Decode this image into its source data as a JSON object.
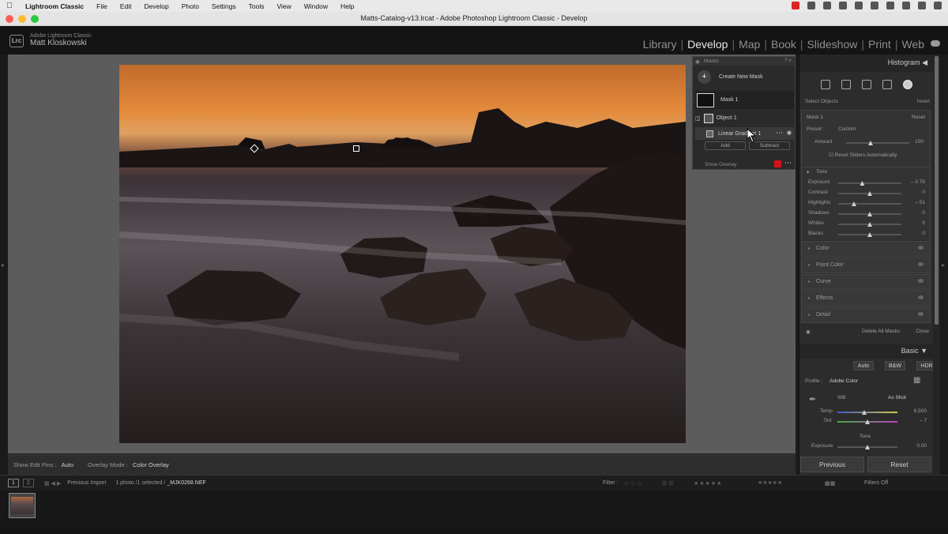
{
  "menubar": {
    "app": "Lightroom Classic",
    "items": [
      "File",
      "Edit",
      "Develop",
      "Photo",
      "Settings",
      "Tools",
      "View",
      "Window",
      "Help"
    ]
  },
  "window": {
    "title": "Matts-Catalog-v13.lrcat - Adobe Photoshop Lightroom Classic - Develop"
  },
  "identity": {
    "app_name": "Adobe Lightroom Classic",
    "user_name": "Matt Kloskowski",
    "logo_text": "Lrc"
  },
  "modules": [
    "Library",
    "Develop",
    "Map",
    "Book",
    "Slideshow",
    "Print",
    "Web"
  ],
  "active_module": "Develop",
  "masks_panel": {
    "title": "Masks",
    "create_label": "Create New Mask",
    "mask1_label": "Mask 1",
    "object_label": "Object 1",
    "linear_label": "Linear Gradient 1",
    "add_label": "Add",
    "subtract_label": "Subtract",
    "show_overlay_label": "Show Overlay",
    "overlay_color": "#d4121b"
  },
  "right_panel": {
    "histogram_title": "Histogram",
    "select_objects": "Select Objects",
    "invert": "Invert",
    "mask_name": "Mask 1",
    "reset": "Reset",
    "preset_label": "Preset :",
    "preset_value": "Custom",
    "amount_label": "Amount",
    "amount_value": "100",
    "reset_sliders_label": "Reset Sliders Automatically",
    "tone_title": "Tone",
    "sliders": [
      {
        "label": "Exposure",
        "value": "– 0.76",
        "pos": 0.38
      },
      {
        "label": "Contrast",
        "value": "0",
        "pos": 0.5
      },
      {
        "label": "Highlights",
        "value": "– 51",
        "pos": 0.25
      },
      {
        "label": "Shadows",
        "value": "0",
        "pos": 0.5
      },
      {
        "label": "Whites",
        "value": "0",
        "pos": 0.5
      },
      {
        "label": "Blacks",
        "value": "0",
        "pos": 0.5
      }
    ],
    "collapsed_sections": [
      "Color",
      "Point Color",
      "Curve",
      "Effects",
      "Detail"
    ],
    "delete_all_masks": "Delete All Masks",
    "close": "Close",
    "basic_title": "Basic",
    "basic_buttons": [
      "Auto",
      "B&W",
      "HDR"
    ],
    "profile_label": "Profile :",
    "profile_value": "Adobe Color",
    "wb_label": "WB",
    "wb_value": "As Shot",
    "temp_label": "Temp",
    "temp_value": "6,500",
    "tint_label": "Tint",
    "tint_value": "– 7",
    "tone2_label": "Tone",
    "exposure2_label": "Exposure",
    "exposure2_value": "0.00",
    "previous_label": "Previous",
    "reset_label": "Reset"
  },
  "canvas_toolbar": {
    "edit_pins_label": "Show Edit Pins :",
    "edit_pins_value": "Auto",
    "overlay_mode_label": "Overlay Mode :",
    "overlay_mode_value": "Color Overlay"
  },
  "filmbar": {
    "page1": "1",
    "page2": "2",
    "source": "Previous Import",
    "count": "1 photo /1 selected /",
    "filename": "_MJK0268.NEF",
    "filter_label": "Filter :",
    "filters_off": "Filters Off"
  }
}
